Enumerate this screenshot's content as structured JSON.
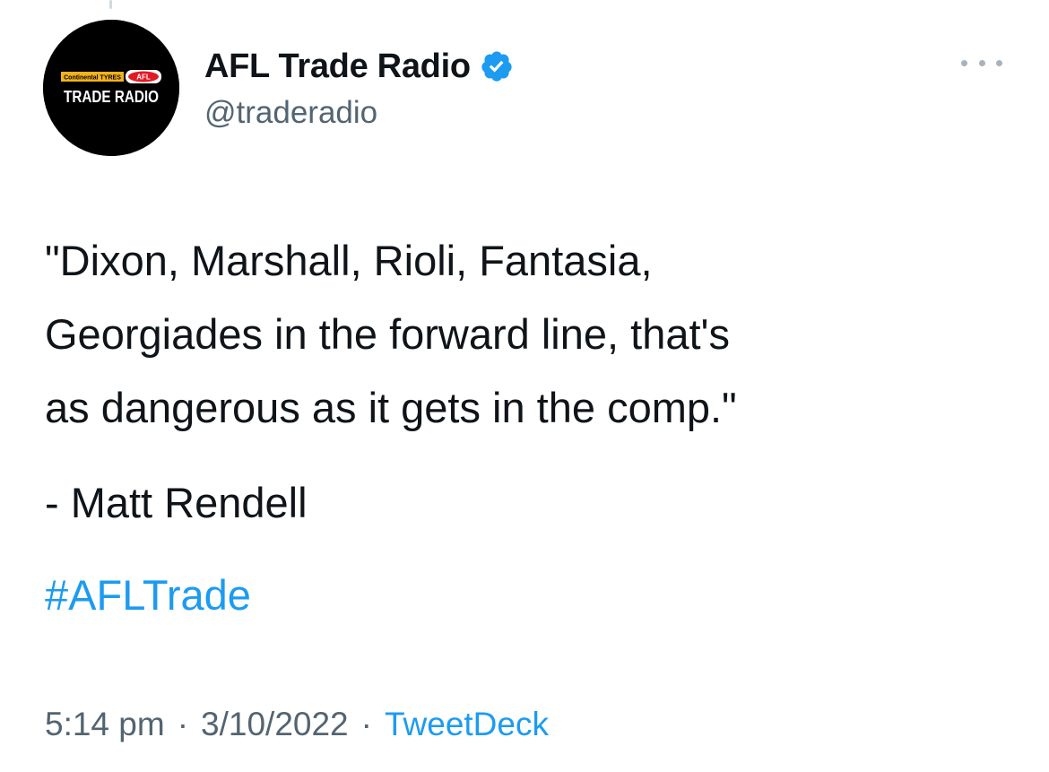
{
  "tweet": {
    "author": {
      "display_name": "AFL Trade Radio",
      "handle": "@traderadio",
      "verified": true,
      "avatar": {
        "logo_text": "TRADE RADIO",
        "sponsor_text": "Continental TYRES",
        "league_badge": "AFL",
        "background": "#000000"
      }
    },
    "text_lines": [
      "\"Dixon, Marshall, Rioli, Fantasia,",
      "Georgiades in the forward line, that's",
      "as dangerous as it gets in the comp.\""
    ],
    "attribution": "- Matt Rendell",
    "hashtag": "#AFLTrade",
    "time": "5:14 pm",
    "date": "3/10/2022",
    "separator": "·",
    "source": "TweetDeck"
  },
  "icons": {
    "verified": "verified-badge-icon",
    "more": "more-options-icon"
  },
  "colors": {
    "text": "#0f1419",
    "secondary": "#536471",
    "link": "#1d9bf0",
    "verified": "#1d9bf0"
  }
}
